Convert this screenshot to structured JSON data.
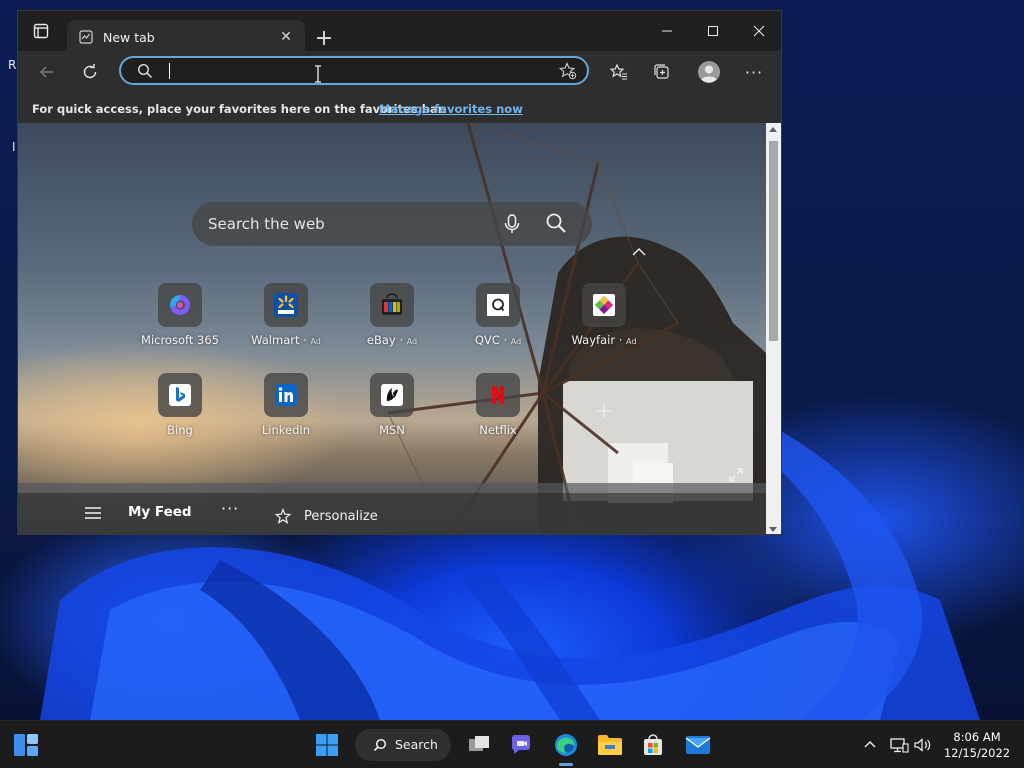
{
  "desktop": {
    "label_fragment": "R",
    "label_fragment2": "I"
  },
  "browser": {
    "tab": {
      "title": "New tab"
    },
    "address_bar": {
      "value": "",
      "placeholder": ""
    },
    "favorites_bar": {
      "text": "For quick access, place your favorites here on the favorites bar.",
      "link": "Manage favorites now"
    },
    "new_tab_page": {
      "search_placeholder": "Search the web",
      "tiles": [
        {
          "label": "Microsoft 365",
          "ad": "",
          "icon": "microsoft-365-icon"
        },
        {
          "label": "Walmart",
          "ad": "Ad",
          "icon": "walmart-icon"
        },
        {
          "label": "eBay",
          "ad": "Ad",
          "icon": "ebay-icon"
        },
        {
          "label": "QVC",
          "ad": "Ad",
          "icon": "qvc-icon"
        },
        {
          "label": "Wayfair",
          "ad": "Ad",
          "icon": "wayfair-icon"
        },
        {
          "label": "Bing",
          "ad": "",
          "icon": "bing-icon"
        },
        {
          "label": "LinkedIn",
          "ad": "",
          "icon": "linkedin-icon"
        },
        {
          "label": "MSN",
          "ad": "",
          "icon": "msn-icon"
        },
        {
          "label": "Netflix",
          "ad": "",
          "icon": "netflix-icon"
        }
      ],
      "feed": {
        "title": "My Feed",
        "more": "···",
        "personalize": "Personalize"
      }
    }
  },
  "taskbar": {
    "search_label": "Search",
    "time": "8:06 AM",
    "date": "12/15/2022",
    "accent": "#62a7d9"
  }
}
